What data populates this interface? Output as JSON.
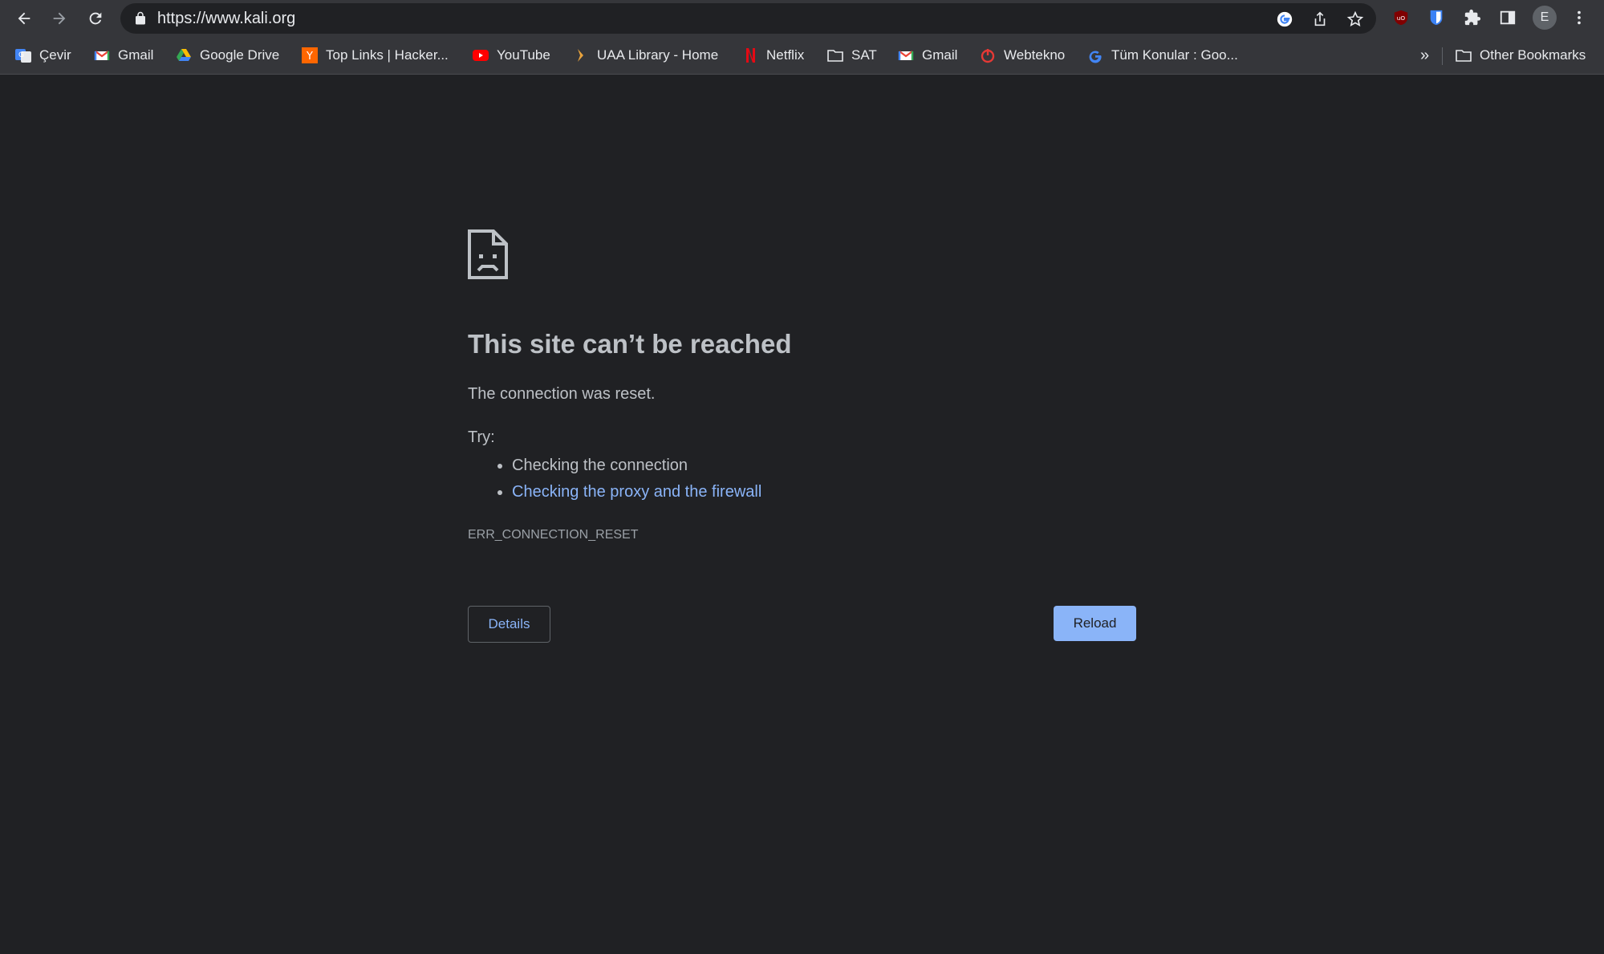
{
  "browser": {
    "url": "https://www.kali.org",
    "profile_initial": "E"
  },
  "bookmarks": {
    "items": [
      {
        "label": "Çevir",
        "icon": "google-translate-icon"
      },
      {
        "label": "Gmail",
        "icon": "gmail-icon"
      },
      {
        "label": "Google Drive",
        "icon": "google-drive-icon"
      },
      {
        "label": "Top Links | Hacker...",
        "icon": "hacker-news-icon"
      },
      {
        "label": "YouTube",
        "icon": "youtube-icon"
      },
      {
        "label": "UAA Library - Home",
        "icon": "uaa-icon"
      },
      {
        "label": "Netflix",
        "icon": "netflix-icon"
      },
      {
        "label": "SAT",
        "icon": "folder-icon"
      },
      {
        "label": "Gmail",
        "icon": "gmail-icon"
      },
      {
        "label": "Webtekno",
        "icon": "webtekno-icon"
      },
      {
        "label": "Tüm Konular : Goo...",
        "icon": "google-icon"
      }
    ],
    "overflow": "»",
    "other": "Other Bookmarks"
  },
  "error": {
    "title": "This site can’t be reached",
    "description": "The connection was reset.",
    "try_label": "Try:",
    "suggestions": [
      "Checking the connection",
      "Checking the proxy and the firewall"
    ],
    "code": "ERR_CONNECTION_RESET",
    "details_button": "Details",
    "reload_button": "Reload"
  },
  "colors": {
    "page_bg": "#202124",
    "toolbar_bg": "#35363a",
    "link": "#8ab4f8",
    "text": "#bdc1c6"
  }
}
